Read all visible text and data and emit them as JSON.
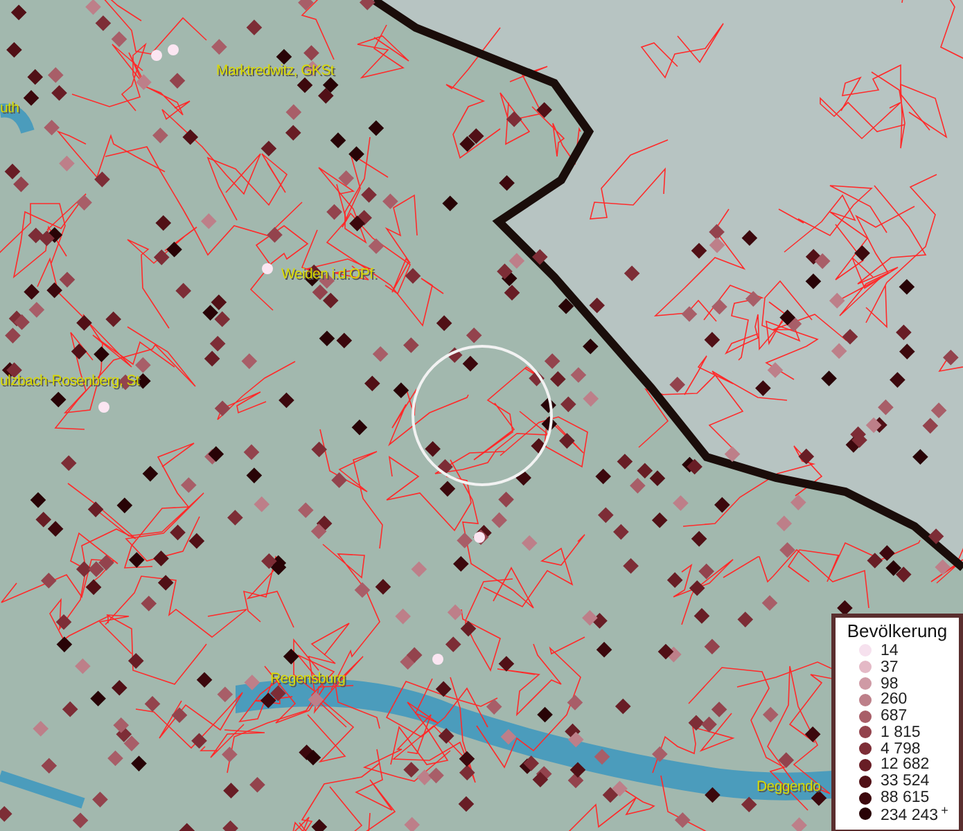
{
  "map": {
    "place_labels": [
      {
        "text": "uth"
      },
      {
        "text": "Marktredwitz, GKSt"
      },
      {
        "text": "Weiden i.d.OPf."
      },
      {
        "text": "ulzbach-Rosenberg, St"
      },
      {
        "text": "Regensburg"
      },
      {
        "text": "Deggendo"
      }
    ]
  },
  "legend": {
    "title": "Bevölkerung",
    "items": [
      {
        "label": "14",
        "color": "#f6e1ee"
      },
      {
        "label": "37",
        "color": "#e4b9c6"
      },
      {
        "label": "98",
        "color": "#cf9aa5"
      },
      {
        "label": "260",
        "color": "#bd7f89"
      },
      {
        "label": "687",
        "color": "#a85e68"
      },
      {
        "label": "1 815",
        "color": "#93434d"
      },
      {
        "label": "4 798",
        "color": "#7d2d36"
      },
      {
        "label": "12 682",
        "color": "#681d25"
      },
      {
        "label": "33 524",
        "color": "#511016"
      },
      {
        "label": "88 615",
        "color": "#3c080d"
      },
      {
        "label": "234 243$^{+}$",
        "color": "#280306"
      }
    ]
  }
}
